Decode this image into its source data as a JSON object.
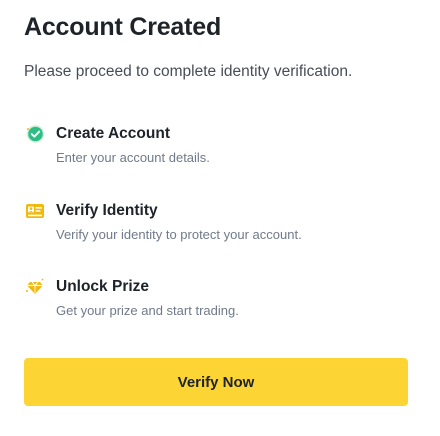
{
  "header": {
    "title": "Account Created",
    "subtitle": "Please proceed to complete identity verification."
  },
  "steps": [
    {
      "title": "Create Account",
      "description": "Enter your account details.",
      "icon": "check-circle-icon",
      "status": "completed",
      "accent": "#2ebd85"
    },
    {
      "title": "Verify Identity",
      "description": "Verify your identity to protect your account.",
      "icon": "id-card-icon",
      "status": "pending",
      "accent": "#f0b90b"
    },
    {
      "title": "Unlock Prize",
      "description": "Get your prize and start trading.",
      "icon": "diamond-icon",
      "status": "pending",
      "accent": "#f0b90b"
    }
  ],
  "actions": {
    "verify_label": "Verify Now",
    "button_color": "#fcd535"
  }
}
